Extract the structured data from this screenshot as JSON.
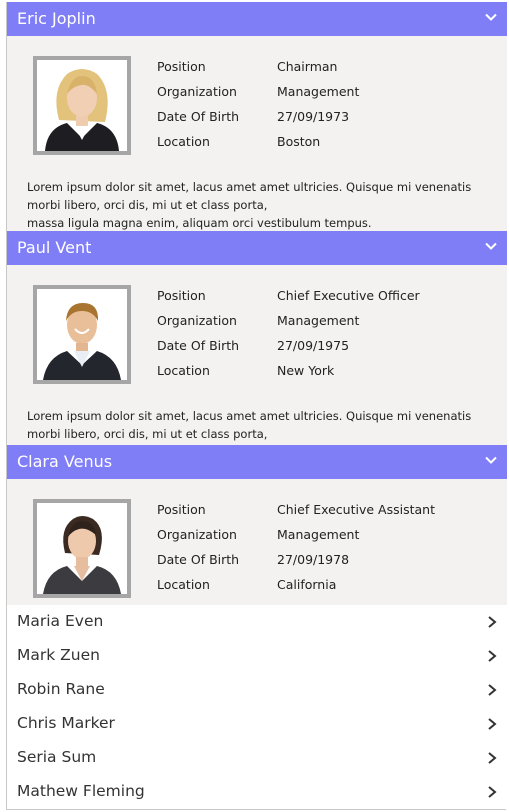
{
  "info_labels": {
    "position": "Position",
    "organization": "Organization",
    "dob": "Date Of Birth",
    "location": "Location"
  },
  "expanded": [
    {
      "name": "Eric Joplin",
      "position": "Chairman",
      "organization": "Management",
      "dob": "27/09/1973",
      "location": "Boston",
      "description_lines": [
        "Lorem ipsum dolor sit amet, lacus amet amet ultricies. Quisque mi venenatis",
        "morbi libero, orci dis, mi ut et class porta,",
        "massa ligula magna enim, aliquam orci vestibulum tempus."
      ]
    },
    {
      "name": "Paul Vent",
      "position": "Chief Executive Officer",
      "organization": "Management",
      "dob": "27/09/1975",
      "location": "New York",
      "description_lines": [
        "Lorem ipsum dolor sit amet, lacus amet amet ultricies. Quisque mi venenatis",
        "morbi libero, orci dis, mi ut et class porta,"
      ]
    },
    {
      "name": "Clara Venus",
      "position": "Chief Executive Assistant",
      "organization": "Management",
      "dob": "27/09/1978",
      "location": "California",
      "description_lines": []
    }
  ],
  "collapsed": [
    {
      "name": "Maria Even"
    },
    {
      "name": "Mark Zuen"
    },
    {
      "name": "Robin Rane"
    },
    {
      "name": "Chris Marker"
    },
    {
      "name": "Seria Sum"
    },
    {
      "name": "Mathew Fleming"
    }
  ],
  "icons": {
    "expanded_header": "chevron-down-icon",
    "collapsed_item": "chevron-right-icon"
  },
  "colors": {
    "header": "#7f7ef7",
    "panel": "#f3f2f1",
    "photo_border": "#a6a6a6"
  }
}
